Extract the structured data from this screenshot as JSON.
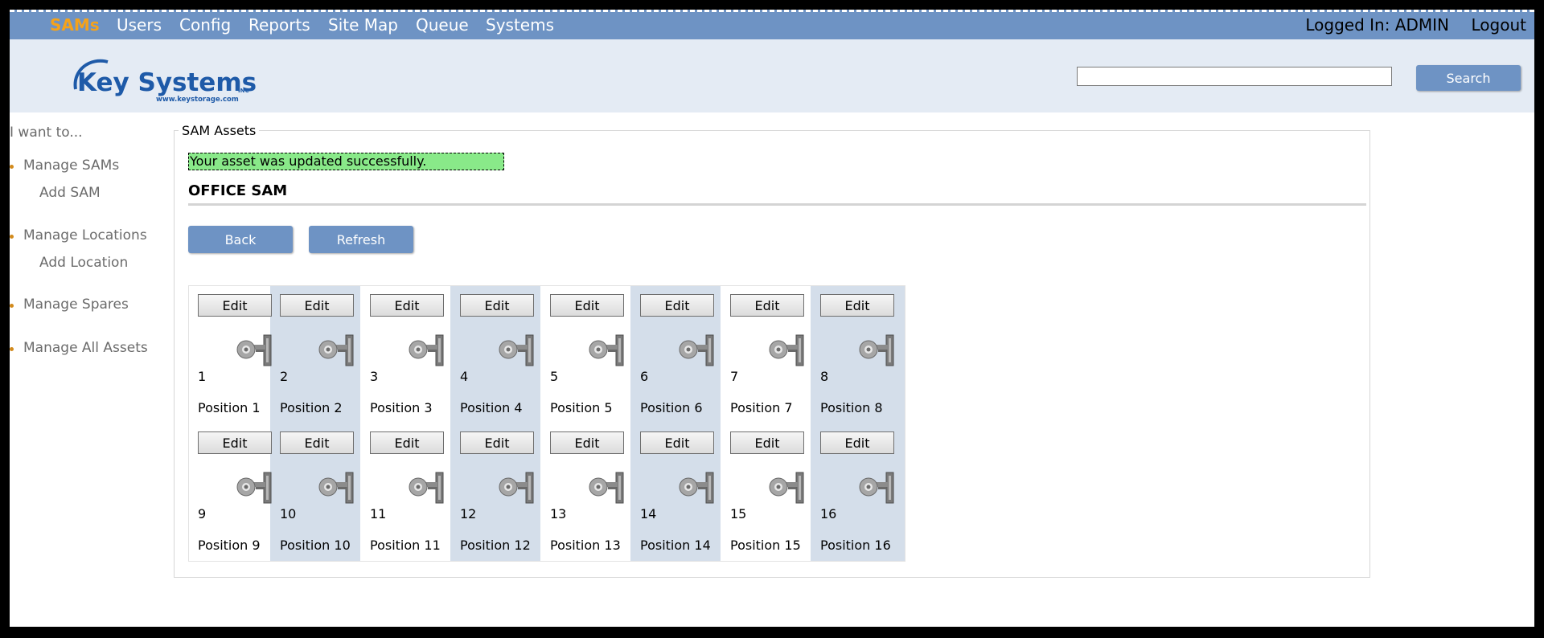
{
  "nav": {
    "items": [
      "SAMs",
      "Users",
      "Config",
      "Reports",
      "Site Map",
      "Queue",
      "Systems"
    ],
    "active": "SAMs",
    "logged_in": "Logged In: ADMIN",
    "logout": "Logout"
  },
  "header": {
    "logo_text": "Key Systems",
    "logo_inc": "INC",
    "logo_url": "www.keystorage.com",
    "search_value": "",
    "search_button": "Search"
  },
  "sidebar": {
    "heading": "I want to...",
    "sections": [
      {
        "label": "Manage SAMs",
        "sub": "Add SAM"
      },
      {
        "label": "Manage Locations",
        "sub": "Add Location"
      },
      {
        "label": "Manage Spares",
        "sub": ""
      },
      {
        "label": "Manage All Assets",
        "sub": ""
      }
    ]
  },
  "panel": {
    "legend": "SAM Assets",
    "message": "Your asset was updated successfully.",
    "title": "OFFICE SAM",
    "back": "Back",
    "refresh": "Refresh",
    "edit_label": "Edit",
    "positions": [
      {
        "num": "1",
        "name": "Position 1"
      },
      {
        "num": "2",
        "name": "Position 2"
      },
      {
        "num": "3",
        "name": "Position 3"
      },
      {
        "num": "4",
        "name": "Position 4"
      },
      {
        "num": "5",
        "name": "Position 5"
      },
      {
        "num": "6",
        "name": "Position 6"
      },
      {
        "num": "7",
        "name": "Position 7"
      },
      {
        "num": "8",
        "name": "Position 8"
      },
      {
        "num": "9",
        "name": "Position 9"
      },
      {
        "num": "10",
        "name": "Position 10"
      },
      {
        "num": "11",
        "name": "Position 11"
      },
      {
        "num": "12",
        "name": "Position 12"
      },
      {
        "num": "13",
        "name": "Position 13"
      },
      {
        "num": "14",
        "name": "Position 14"
      },
      {
        "num": "15",
        "name": "Position 15"
      },
      {
        "num": "16",
        "name": "Position 16"
      }
    ]
  },
  "colors": {
    "nav_bg": "#6e93c4",
    "nav_active": "#f4a21b",
    "header_bg": "#e4ebf4",
    "success_bg": "#89e989",
    "column_alt": "#d4deea"
  }
}
